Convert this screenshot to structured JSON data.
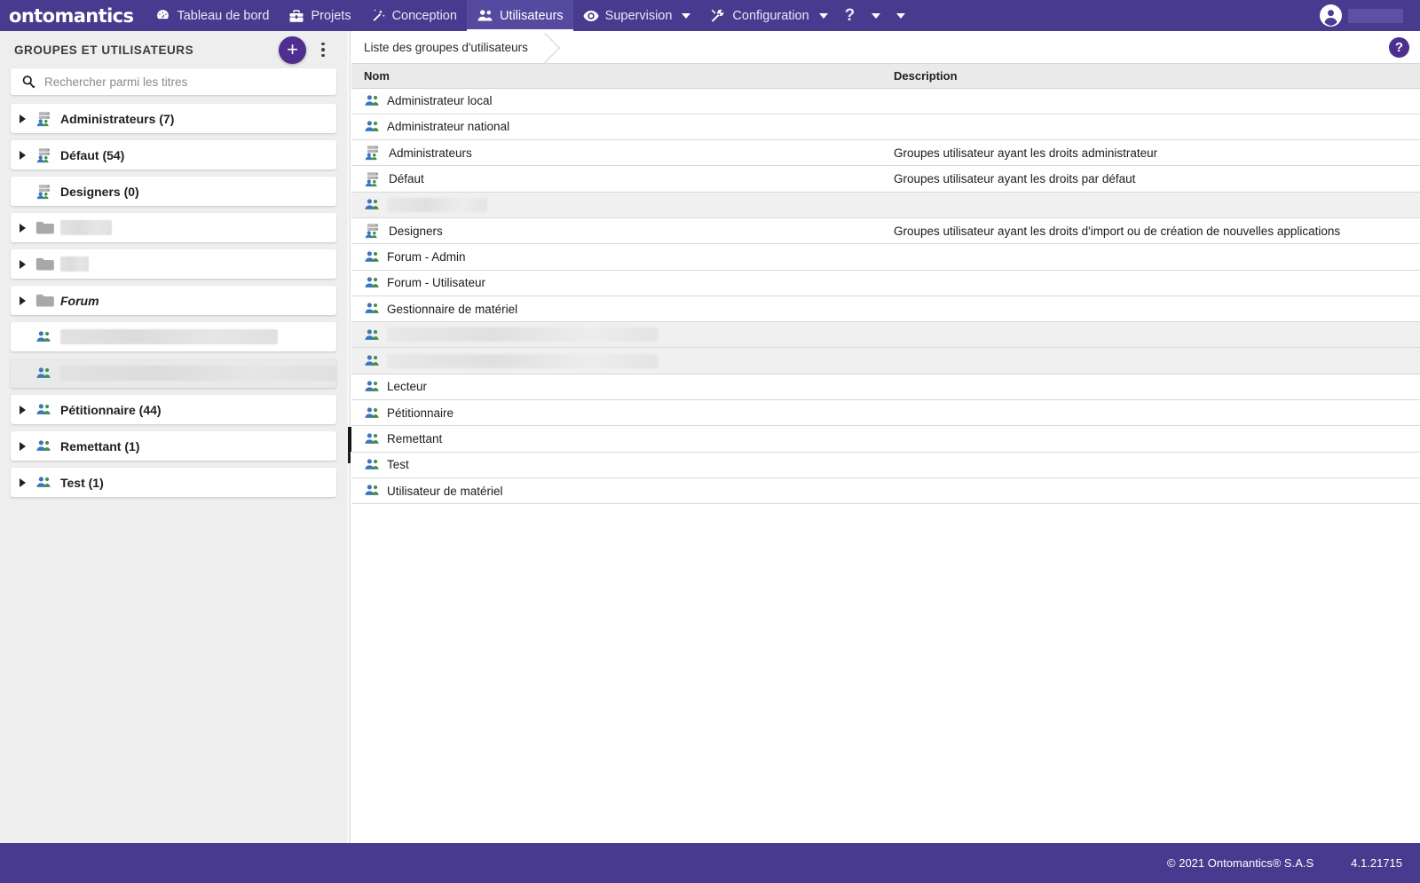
{
  "app": {
    "logo_text": "ontomantics",
    "nav": [
      {
        "label": "Tableau de bord",
        "icon": "dashboard-icon",
        "active": false,
        "caret": false
      },
      {
        "label": "Projets",
        "icon": "toolbox-icon",
        "active": false,
        "caret": false
      },
      {
        "label": "Conception",
        "icon": "magic-wand-icon",
        "active": false,
        "caret": false
      },
      {
        "label": "Utilisateurs",
        "icon": "users-icon",
        "active": true,
        "caret": false
      },
      {
        "label": "Supervision",
        "icon": "eye-icon",
        "active": false,
        "caret": true
      },
      {
        "label": "Configuration",
        "icon": "tools-icon",
        "active": false,
        "caret": true
      }
    ],
    "help_nav_label": "?",
    "user": {
      "name_redacted": true,
      "avatar": "account-circle-icon"
    }
  },
  "sidebar": {
    "title": "GROUPES ET UTILISATEURS",
    "add_label": "+",
    "menu_label": "more-options",
    "search": {
      "placeholder": "Rechercher parmi les titres",
      "value": ""
    },
    "items": [
      {
        "label": "Administrateurs (7)",
        "icon": "server-group-icon",
        "arrow": true,
        "redacted": false,
        "italic": false,
        "selected": false
      },
      {
        "label": "Défaut (54)",
        "icon": "server-group-icon",
        "arrow": true,
        "redacted": false,
        "italic": false,
        "selected": false
      },
      {
        "label": "Designers (0)",
        "icon": "server-group-icon",
        "arrow": false,
        "redacted": false,
        "italic": false,
        "selected": false
      },
      {
        "label": "",
        "icon": "folder-icon",
        "arrow": true,
        "redacted": true,
        "redact_width": 58,
        "italic": false,
        "selected": false
      },
      {
        "label": "",
        "icon": "folder-icon",
        "arrow": true,
        "redacted": true,
        "redact_width": 32,
        "italic": false,
        "selected": false
      },
      {
        "label": "Forum",
        "icon": "folder-icon",
        "arrow": true,
        "redacted": false,
        "italic": true,
        "selected": false
      },
      {
        "label": "",
        "icon": "people-icon",
        "arrow": false,
        "redacted": true,
        "redact_width": 245,
        "italic": false,
        "selected": false
      },
      {
        "label": "",
        "icon": "people-icon",
        "arrow": false,
        "redacted": true,
        "redact_width": 316,
        "italic": false,
        "selected": true
      },
      {
        "label": "Pétitionnaire (44)",
        "icon": "people-icon",
        "arrow": true,
        "redacted": false,
        "italic": false,
        "selected": false
      },
      {
        "label": "Remettant (1)",
        "icon": "people-icon",
        "arrow": true,
        "redacted": false,
        "italic": false,
        "selected": false
      },
      {
        "label": "Test (1)",
        "icon": "people-icon",
        "arrow": true,
        "redacted": false,
        "italic": false,
        "selected": false
      }
    ]
  },
  "main": {
    "breadcrumb": "Liste des groupes d'utilisateurs",
    "help_label": "?",
    "columns": {
      "name": "Nom",
      "description": "Description"
    },
    "rows": [
      {
        "name": "Administrateur local",
        "description": "",
        "icon": "people-icon",
        "redacted": false,
        "shaded": false
      },
      {
        "name": "Administrateur national",
        "description": "",
        "icon": "people-icon",
        "redacted": false,
        "shaded": false
      },
      {
        "name": "Administrateurs",
        "description": "Groupes utilisateur ayant les droits administrateur",
        "icon": "server-group-icon",
        "redacted": false,
        "shaded": false
      },
      {
        "name": "Défaut",
        "description": "Groupes utilisateur ayant les droits par défaut",
        "icon": "server-group-icon",
        "redacted": false,
        "shaded": false
      },
      {
        "name": "",
        "description": "",
        "icon": "people-icon",
        "redacted": true,
        "redact_width": 113,
        "shaded": true
      },
      {
        "name": "Designers",
        "description": "Groupes utilisateur ayant les droits d'import ou de création de nouvelles applications",
        "icon": "server-group-icon",
        "redacted": false,
        "shaded": false
      },
      {
        "name": "Forum - Admin",
        "description": "",
        "icon": "people-icon",
        "redacted": false,
        "shaded": false
      },
      {
        "name": "Forum - Utilisateur",
        "description": "",
        "icon": "people-icon",
        "redacted": false,
        "shaded": false
      },
      {
        "name": "Gestionnaire de matériel",
        "description": "",
        "icon": "people-icon",
        "redacted": false,
        "shaded": false
      },
      {
        "name": "",
        "description": "",
        "icon": "people-icon",
        "redacted": true,
        "redact_width": 305,
        "shaded": true
      },
      {
        "name": "",
        "description": "",
        "icon": "people-icon",
        "redacted": true,
        "redact_width": 305,
        "shaded": true
      },
      {
        "name": "Lecteur",
        "description": "",
        "icon": "people-icon",
        "redacted": false,
        "shaded": false
      },
      {
        "name": "Pétitionnaire",
        "description": "",
        "icon": "people-icon",
        "redacted": false,
        "shaded": false
      },
      {
        "name": "Remettant",
        "description": "",
        "icon": "people-icon",
        "redacted": false,
        "shaded": false
      },
      {
        "name": "Test",
        "description": "",
        "icon": "people-icon",
        "redacted": false,
        "shaded": false
      },
      {
        "name": "Utilisateur de matériel",
        "description": "",
        "icon": "people-icon",
        "redacted": false,
        "shaded": false
      }
    ]
  },
  "footer": {
    "copyright": "© 2021 Ontomantics® S.A.S",
    "version": "4.1.21715"
  },
  "colors": {
    "brand_purple": "#483b8f",
    "accent_purple": "#4e2f8f",
    "active_tab": "#554aa0",
    "icon_blue": "#3d75b8",
    "icon_green": "#3f9047",
    "folder_gray": "#a8a8a8"
  }
}
